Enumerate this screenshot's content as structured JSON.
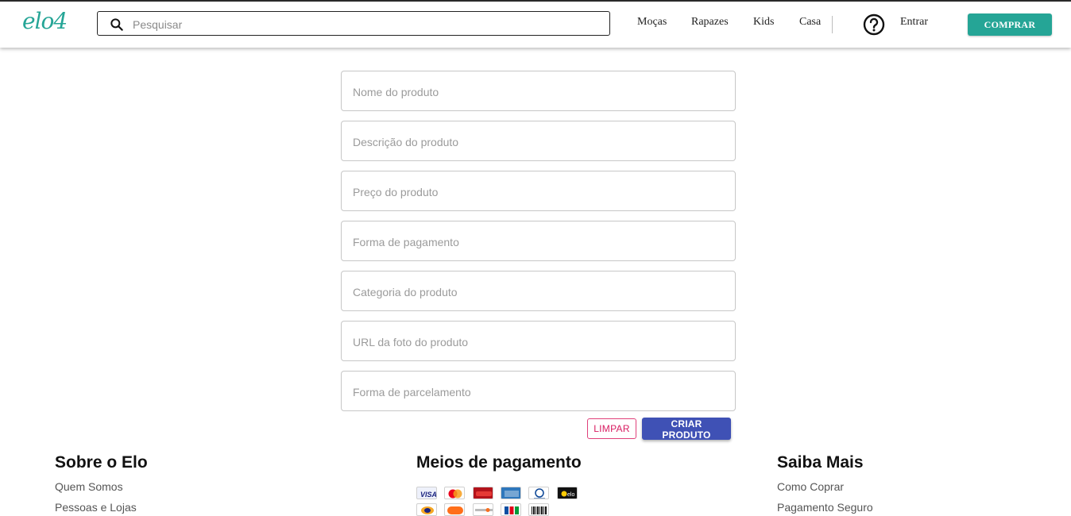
{
  "header": {
    "logo": "elo4",
    "search_placeholder": "Pesquisar",
    "nav": [
      "Moças",
      "Rapazes",
      "Kids",
      "Casa"
    ],
    "login": "Entrar",
    "buy_button": "COMPRAR",
    "accent": "#25a596"
  },
  "form": {
    "fields": [
      {
        "placeholder": "Nome do produto"
      },
      {
        "placeholder": "Descrição do produto"
      },
      {
        "placeholder": "Preço do produto"
      },
      {
        "placeholder": "Forma de pagamento"
      },
      {
        "placeholder": "Categoria do produto"
      },
      {
        "placeholder": "URL da foto do produto"
      },
      {
        "placeholder": "Forma de parcelamento"
      }
    ],
    "clear_button": "LIMPAR",
    "create_button": "CRIAR PRODUTO",
    "clear_color": "#d81b60",
    "create_color": "#3f51b5"
  },
  "footer": {
    "about": {
      "title": "Sobre o Elo",
      "links": [
        "Quem Somos",
        "Pessoas e Lojas"
      ]
    },
    "payment": {
      "title": "Meios de pagamento",
      "icons": [
        "visa-icon",
        "mastercard-icon",
        "hipercard-icon",
        "amex-icon",
        "diners-icon",
        "elo-card-icon",
        "hiper-icon",
        "mercadopago-icon",
        "discover-icon",
        "jcb-icon",
        "boleto-icon"
      ]
    },
    "more": {
      "title": "Saiba Mais",
      "links": [
        "Como Coprar",
        "Pagamento Seguro"
      ]
    }
  }
}
